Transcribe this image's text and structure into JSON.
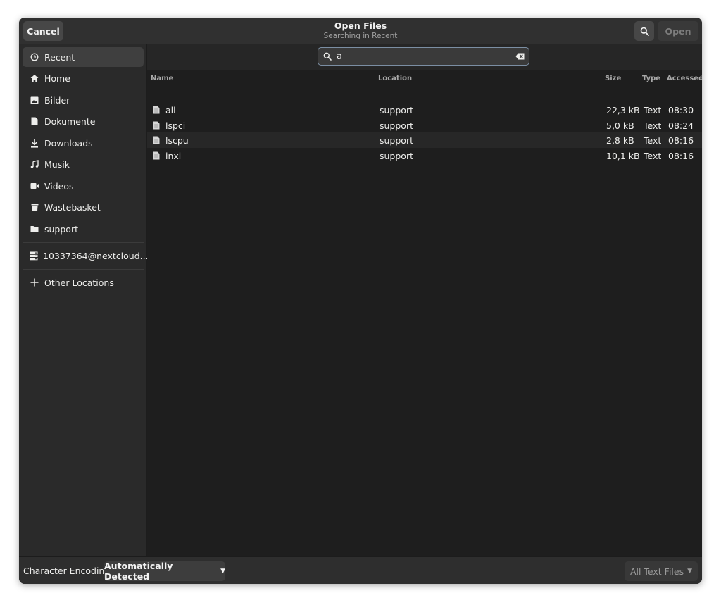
{
  "header": {
    "cancel_label": "Cancel",
    "title": "Open Files",
    "subtitle": "Searching in Recent",
    "open_label": "Open"
  },
  "sidebar": {
    "items": [
      {
        "label": "Recent",
        "icon": "clock-icon",
        "active": true
      },
      {
        "label": "Home",
        "icon": "home-icon"
      },
      {
        "label": "Bilder",
        "icon": "image-icon"
      },
      {
        "label": "Dokumente",
        "icon": "document-icon"
      },
      {
        "label": "Downloads",
        "icon": "download-icon"
      },
      {
        "label": "Musik",
        "icon": "music-icon"
      },
      {
        "label": "Videos",
        "icon": "video-icon"
      },
      {
        "label": "Wastebasket",
        "icon": "trash-icon"
      },
      {
        "label": "support",
        "icon": "folder-icon"
      }
    ],
    "network": {
      "label": "10337364@nextcloud....",
      "icon": "server-icon"
    },
    "other_locations": {
      "label": "Other Locations",
      "icon": "plus-icon"
    }
  },
  "search": {
    "value": "a"
  },
  "columns": {
    "name": "Name",
    "location": "Location",
    "size": "Size",
    "type": "Type",
    "accessed": "Accessed"
  },
  "files": [
    {
      "name": "all",
      "location": "support",
      "size": "22,3 kB",
      "type": "Text",
      "accessed": "08:30"
    },
    {
      "name": "lspci",
      "location": "support",
      "size": "5,0 kB",
      "type": "Text",
      "accessed": "08:24"
    },
    {
      "name": "lscpu",
      "location": "support",
      "size": "2,8 kB",
      "type": "Text",
      "accessed": "08:16"
    },
    {
      "name": "inxi",
      "location": "support",
      "size": "10,1 kB",
      "type": "Text",
      "accessed": "08:16"
    }
  ],
  "footer": {
    "encoding_label": "Character Encoding:",
    "encoding_value": "Automatically Detected",
    "filter_value": "All Text Files"
  }
}
